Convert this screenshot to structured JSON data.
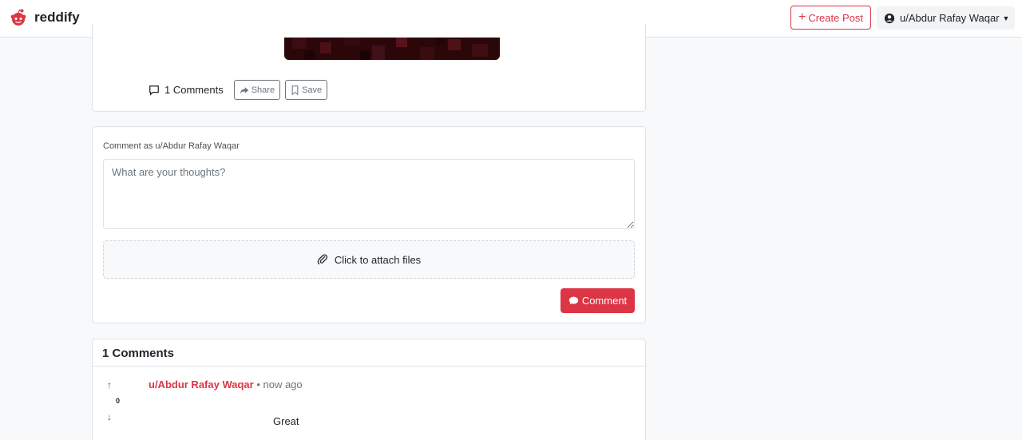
{
  "navbar": {
    "brand": "reddify",
    "create_post": "Create Post",
    "user": "u/Abdur Rafay Waqar"
  },
  "post": {
    "comments_link": "1 Comments",
    "share": "Share",
    "save": "Save"
  },
  "comment_form": {
    "label": "Comment as u/Abdur Rafay Waqar",
    "placeholder": "What are your thoughts?",
    "attach": "Click to attach files",
    "submit": "Comment"
  },
  "comments": {
    "header": "1 Comments",
    "items": [
      {
        "author": "u/Abdur Rafay Waqar",
        "time": "• now ago",
        "votes": "0",
        "body": "Great"
      }
    ]
  },
  "colors": {
    "accent": "#dc3545",
    "background": "#f8f9fa"
  }
}
